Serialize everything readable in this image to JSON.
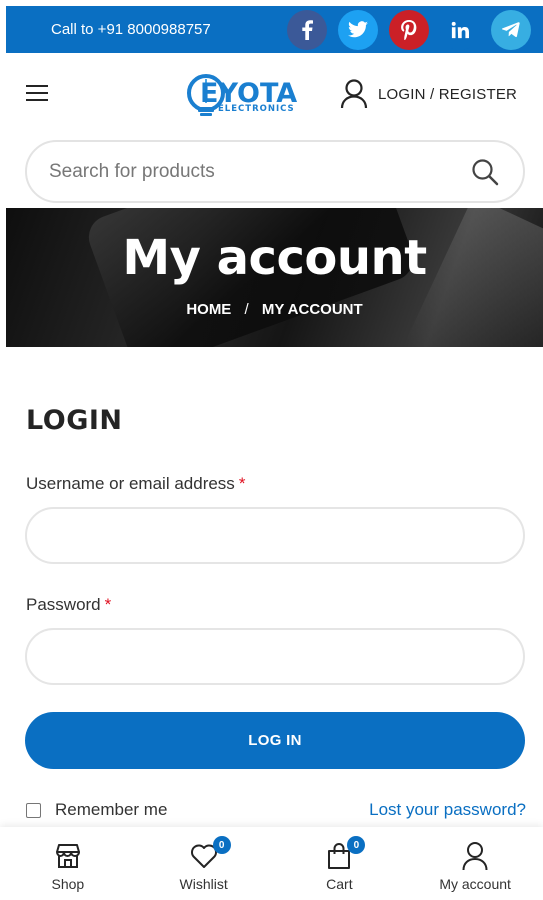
{
  "topbar": {
    "call_text": "Call to +91 8000988757",
    "socials": [
      {
        "name": "facebook",
        "color": "#3b5998"
      },
      {
        "name": "twitter",
        "color": "#1da1f2"
      },
      {
        "name": "pinterest",
        "color": "#cb2027"
      },
      {
        "name": "linkedin",
        "color": "#0a6fc2"
      },
      {
        "name": "telegram",
        "color": "#37aee2"
      }
    ]
  },
  "header": {
    "logo_main": "EYOTA",
    "logo_sub": "ELECTRONICS",
    "login_register": "LOGIN / REGISTER"
  },
  "search": {
    "placeholder": "Search for products"
  },
  "banner": {
    "title": "My account",
    "breadcrumb": {
      "home": "HOME",
      "separator": "/",
      "current": "MY ACCOUNT"
    }
  },
  "login": {
    "title": "LOGIN",
    "username_label": "Username or email address",
    "password_label": "Password",
    "required_mark": "*",
    "button": "LOG IN",
    "remember": "Remember me",
    "lost_password": "Lost your password?"
  },
  "bottom_nav": {
    "shop": "Shop",
    "wishlist": "Wishlist",
    "wishlist_count": "0",
    "cart": "Cart",
    "cart_count": "0",
    "account": "My account"
  },
  "colors": {
    "primary": "#0a6fc2",
    "required": "#e01020"
  }
}
